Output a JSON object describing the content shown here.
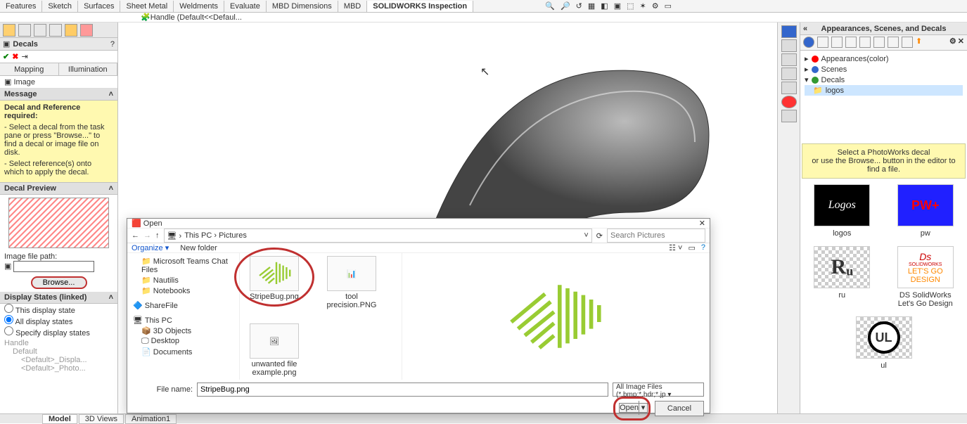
{
  "ribbon": {
    "tabs": [
      "Features",
      "Sketch",
      "Surfaces",
      "Sheet Metal",
      "Weldments",
      "Evaluate",
      "MBD Dimensions",
      "MBD",
      "SOLIDWORKS Inspection"
    ],
    "active": "SOLIDWORKS Inspection"
  },
  "breadcrumb": "Handle  (Default<<Defaul...",
  "pm": {
    "title": "Decals",
    "tabs": [
      "Image",
      "Mapping",
      "Illumination"
    ],
    "message_hdr": "Message",
    "message_bold": "Decal and Reference required:",
    "message1": "- Select a decal from the task pane or press \"Browse...\" to find a decal or image file on disk.",
    "message2": "- Select reference(s) onto which to apply the decal.",
    "preview_hdr": "Decal Preview",
    "ifp_label": "Image file path:",
    "browse": "Browse...",
    "ds_hdr": "Display States (linked)",
    "ds_radio": [
      "This display state",
      "All display states",
      "Specify display states"
    ],
    "ds_items": [
      "Handle",
      "Default",
      "<Default>_Displa...",
      "<Default>_Photo..."
    ]
  },
  "taskpane": {
    "title": "Appearances, Scenes, and Decals",
    "tree": [
      {
        "label": "Appearances(color)",
        "indent": 0,
        "color": "red",
        "exp": "▸"
      },
      {
        "label": "Scenes",
        "indent": 0,
        "color": "blue",
        "exp": "▸"
      },
      {
        "label": "Decals",
        "indent": 0,
        "color": "gr",
        "exp": "▾"
      },
      {
        "label": "logos",
        "indent": 1,
        "sel": true
      }
    ],
    "msg1": "Select a PhotoWorks decal",
    "msg2": "or use the Browse... button in the editor to find a file.",
    "thumbs": [
      {
        "name": "logos",
        "kind": "logos"
      },
      {
        "name": "pw",
        "kind": "pw"
      },
      {
        "name": "ru",
        "kind": "ru"
      },
      {
        "name": "DS SolidWorks Let's Go Design",
        "kind": "ds"
      },
      {
        "name": "ul",
        "kind": "ul"
      }
    ]
  },
  "dialog": {
    "title": "Open",
    "path": "This PC  ›  Pictures",
    "search_ph": "Search Pictures",
    "organize": "Organize ▾",
    "newfolder": "New folder",
    "side": [
      "Microsoft Teams Chat Files",
      "Nautilis",
      "Notebooks",
      "ShareFile",
      "This PC",
      "3D Objects",
      "Desktop",
      "Documents"
    ],
    "files": [
      {
        "name": "StripeBug.png",
        "kind": "stripe",
        "circled": true
      },
      {
        "name": "tool precision.PNG",
        "kind": "blank"
      },
      {
        "name": "unwanted file example.png",
        "kind": "blank"
      }
    ],
    "fn_label": "File name:",
    "fn_value": "StripeBug.png",
    "filter": "All Image Files (*.bmp;*.hdr;*.jp ▾",
    "open": "Open",
    "cancel": "Cancel"
  },
  "bottom": {
    "tabs": [
      "Model",
      "3D Views",
      "Animation1"
    ],
    "active": "Model"
  }
}
